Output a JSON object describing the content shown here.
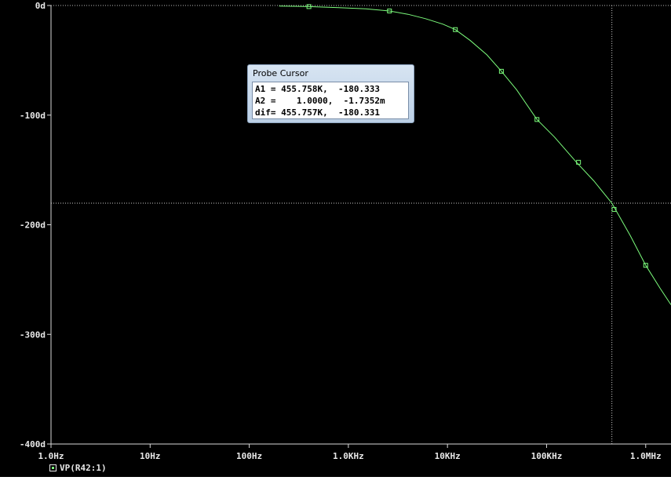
{
  "chart_data": {
    "type": "line",
    "x_scale": "log",
    "xlim": [
      1,
      1800000
    ],
    "ylim": [
      -400,
      0
    ],
    "x_ticks": [
      {
        "value": 1,
        "label": "1.0Hz"
      },
      {
        "value": 10,
        "label": "10Hz"
      },
      {
        "value": 100,
        "label": "100Hz"
      },
      {
        "value": 1000,
        "label": "1.0KHz"
      },
      {
        "value": 10000,
        "label": "10KHz"
      },
      {
        "value": 100000,
        "label": "100KHz"
      },
      {
        "value": 1000000,
        "label": "1.0MHz"
      }
    ],
    "y_ticks": [
      {
        "value": 0,
        "label": "0d"
      },
      {
        "value": -100,
        "label": "-100d"
      },
      {
        "value": -200,
        "label": "-200d"
      },
      {
        "value": -300,
        "label": "-300d"
      },
      {
        "value": -400,
        "label": "-400d"
      }
    ],
    "series": [
      {
        "name": "VP(R42:1)",
        "color": "#7CFC7C",
        "x": [
          200,
          400,
          800,
          1500,
          2600,
          4000,
          6000,
          9000,
          12000,
          17000,
          25000,
          35000,
          50000,
          80000,
          120000,
          200000,
          300000,
          455758,
          700000,
          1000000,
          1400000,
          1800000
        ],
        "y": [
          -0.5,
          -1,
          -2,
          -3,
          -5,
          -8,
          -12,
          -17,
          -22,
          -32,
          -45,
          -60,
          -77,
          -104,
          -120,
          -143,
          -160,
          -180.333,
          -210,
          -237,
          -258,
          -273
        ]
      }
    ],
    "markers": [
      {
        "x": 400,
        "y": -1
      },
      {
        "x": 2600,
        "y": -5
      },
      {
        "x": 12000,
        "y": -22
      },
      {
        "x": 35000,
        "y": -60
      },
      {
        "x": 80000,
        "y": -104
      },
      {
        "x": 210000,
        "y": -143
      },
      {
        "x": 480000,
        "y": -186
      },
      {
        "x": 1000000,
        "y": -237
      }
    ],
    "cursor": {
      "x": 455758,
      "y": -180.333
    }
  },
  "probe_cursor": {
    "title": "Probe Cursor",
    "rows": [
      "A1 = 455.758K,  -180.333",
      "A2 =    1.0000,  -1.7352m",
      "dif= 455.757K,  -180.331"
    ]
  },
  "legend": {
    "label": "VP(R42:1)"
  }
}
